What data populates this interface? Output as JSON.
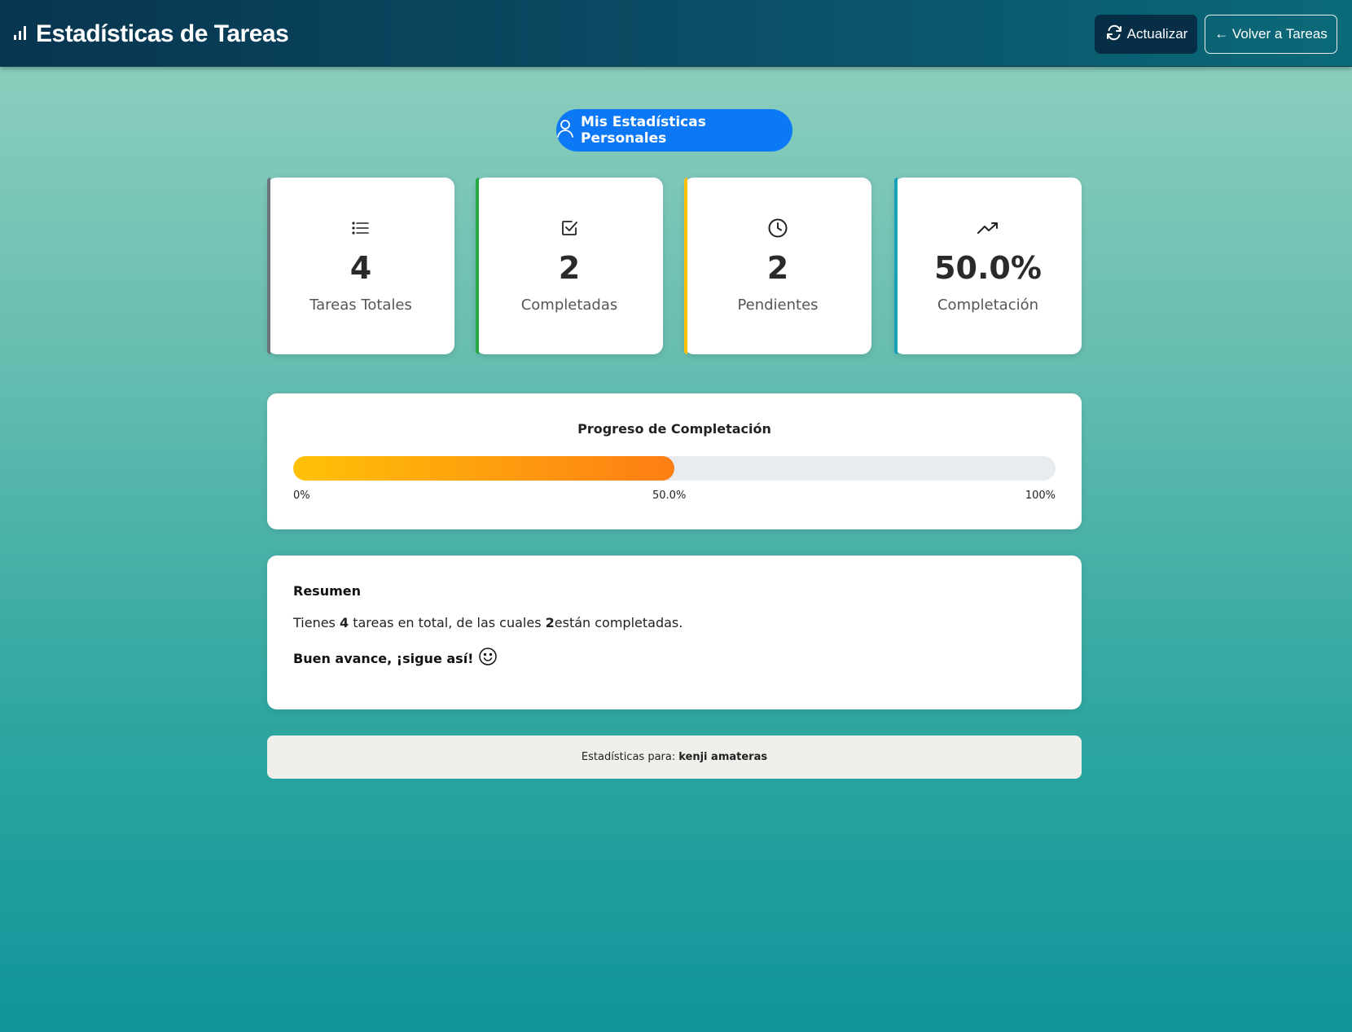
{
  "header": {
    "title": "Estadísticas de Tareas",
    "icon": "bar-chart-icon",
    "refresh_label": "Actualizar",
    "back_label": "← Volver a Tareas"
  },
  "personal_button": {
    "label": "Mis Estadísticas Personales",
    "icon": "person-icon",
    "color": "#0d78f5"
  },
  "cards": [
    {
      "value": "4",
      "label": "Tareas Totales",
      "icon": "list-icon",
      "accent": "#6c757d"
    },
    {
      "value": "2",
      "label": "Completadas",
      "icon": "check-square-icon",
      "accent": "#28a745"
    },
    {
      "value": "2",
      "label": "Pendientes",
      "icon": "clock-icon",
      "accent": "#ffc107"
    },
    {
      "value": "50.0%",
      "label": "Completación",
      "icon": "trending-up-icon",
      "accent": "#17a2b8"
    }
  ],
  "progress": {
    "title": "Progreso de Completación",
    "percent": 50,
    "min_label": "0%",
    "mid_label": "50.0%",
    "max_label": "100%"
  },
  "summary": {
    "title": "Resumen",
    "line_prefix": "Tienes ",
    "total": "4",
    "line_mid": " tareas en total, de las cuales ",
    "completed": "2",
    "line_suffix": "están completadas.",
    "encouragement": "Buen avance, ¡sigue así!",
    "emoji_icon": "smile-icon"
  },
  "footer": {
    "prefix": "Estadísticas para:",
    "user": "kenji amateras"
  }
}
